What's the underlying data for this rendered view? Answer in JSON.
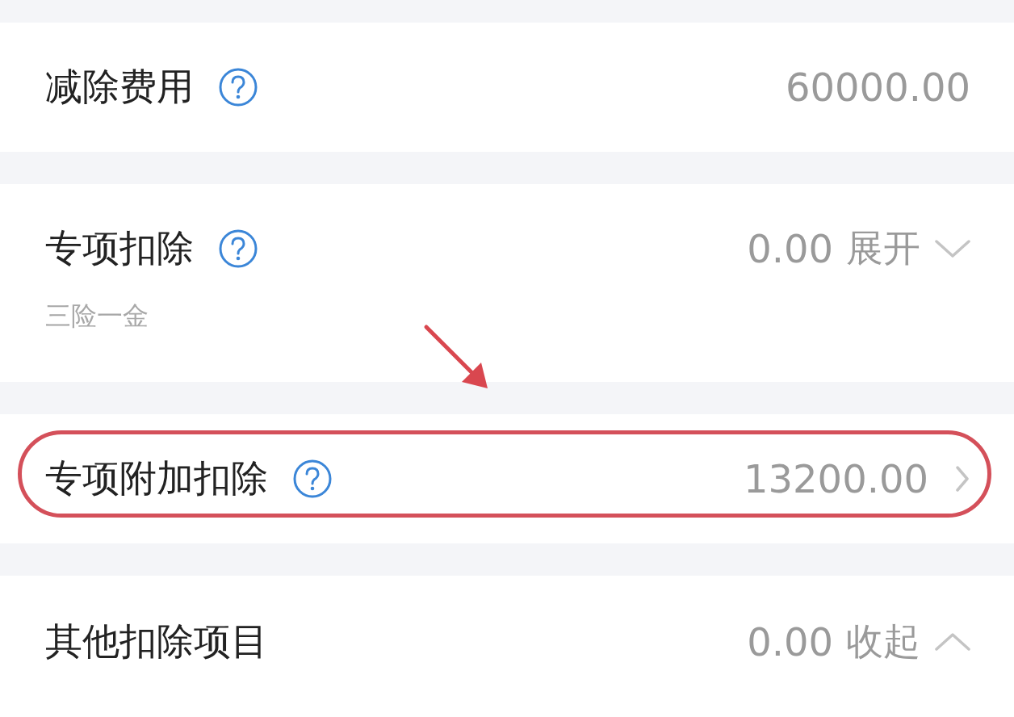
{
  "rows": [
    {
      "kind": "plain",
      "label": "减除费用",
      "help": true,
      "value": "60000.00",
      "highlighted": false
    },
    {
      "kind": "collapsible",
      "label": "专项扣除",
      "help": true,
      "value": "0.00",
      "action": "展开",
      "expanded": false,
      "subtitle": "三险一金",
      "highlighted": false
    },
    {
      "kind": "link",
      "label": "专项附加扣除",
      "help": true,
      "value": "13200.00",
      "highlighted": true
    },
    {
      "kind": "collapsible",
      "label": "其他扣除项目",
      "help": false,
      "value": "0.00",
      "action": "收起",
      "expanded": true,
      "highlighted": false
    }
  ]
}
